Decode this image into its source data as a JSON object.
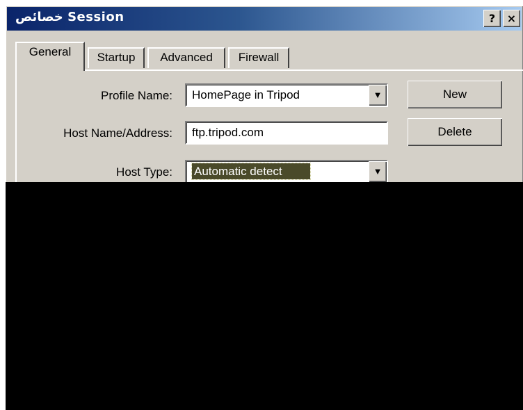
{
  "window": {
    "title": "خصائص  Session",
    "help_glyph": "?",
    "close_glyph": "×"
  },
  "tabs": [
    {
      "label": "General",
      "active": true
    },
    {
      "label": "Startup",
      "active": false
    },
    {
      "label": "Advanced",
      "active": false
    },
    {
      "label": "Firewall",
      "active": false
    }
  ],
  "form": {
    "profile_name": {
      "label": "Profile Name:",
      "value": "HomePage in Tripod"
    },
    "host_name": {
      "label": "Host Name/Address:",
      "value": "ftp.tripod.com"
    },
    "host_type": {
      "label": "Host Type:",
      "value": "Automatic detect"
    }
  },
  "buttons": {
    "new": "New",
    "delete": "Delete"
  },
  "icons": {
    "dropdown": "chevron-down-icon"
  },
  "colors": {
    "titlebar_start": "#0a246a",
    "titlebar_end": "#a6caf0",
    "dialog_face": "#d4d0c8",
    "selection": "#4a4a2a",
    "redaction": "#000000"
  }
}
